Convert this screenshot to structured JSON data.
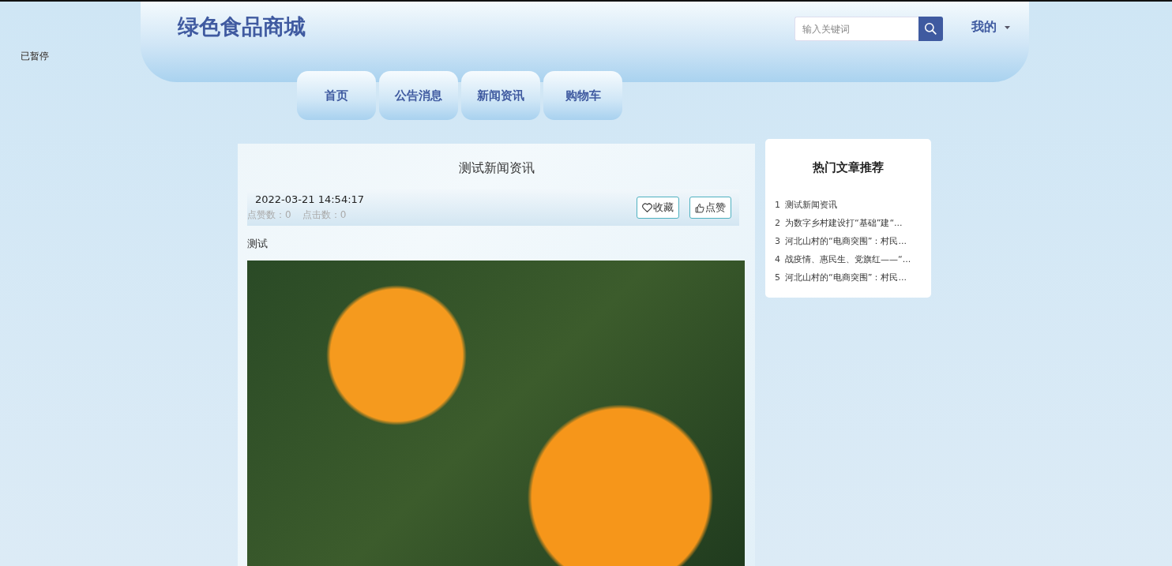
{
  "overlay_label": "已暂停",
  "header": {
    "site_title": "绿色食品商城",
    "search": {
      "placeholder": "输入关键词"
    },
    "user_menu": "我的"
  },
  "nav": [
    {
      "label": "首页"
    },
    {
      "label": "公告消息"
    },
    {
      "label": "新闻资讯"
    },
    {
      "label": "购物车"
    }
  ],
  "article": {
    "title": "测试新闻资讯",
    "date": "2022-03-21 14:54:17",
    "likes": "点赞数：0",
    "clicks": "点击数：0",
    "buttons": [
      {
        "kind": "favorite",
        "label": "收藏"
      },
      {
        "kind": "like",
        "label": "点赞"
      }
    ],
    "body": "测试"
  },
  "sidebar": {
    "title": "热门文章推荐",
    "items": [
      {
        "number": "1",
        "title": "测试新闻资讯"
      },
      {
        "number": "2",
        "title": "为数字乡村建设打“基础”建“..."
      },
      {
        "number": "3",
        "title": "河北山村的“电商突围”：村民..."
      },
      {
        "number": "4",
        "title": "战疫情、惠民生、党旗红——“..."
      },
      {
        "number": "5",
        "title": "河北山村的“电商突围”：村民..."
      }
    ]
  }
}
